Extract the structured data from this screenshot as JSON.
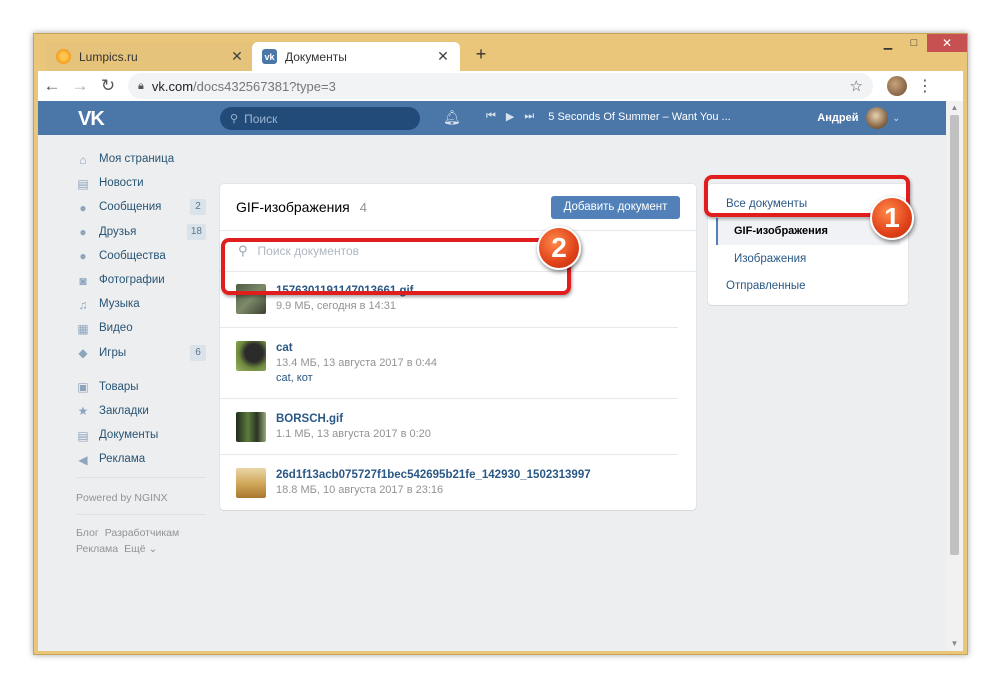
{
  "browser": {
    "tabs": [
      {
        "title": "Lumpics.ru",
        "active": false
      },
      {
        "title": "Документы",
        "active": true
      }
    ],
    "url_host": "vk.com",
    "url_path": "/docs432567381?type=3",
    "new_tab": "+",
    "close_glyph": "✕",
    "window_controls": {
      "minimize": "▁",
      "maximize": "□",
      "close": "✕"
    }
  },
  "vk_header": {
    "logo": "VK",
    "search_placeholder": "Поиск",
    "track": "5 Seconds Of Summer – Want You ...",
    "user_name": "Андрей"
  },
  "left_menu": {
    "items": [
      {
        "label": "Моя страница",
        "icon": "home-icon",
        "glyph": "⌂"
      },
      {
        "label": "Новости",
        "icon": "news-icon",
        "glyph": "▤"
      },
      {
        "label": "Сообщения",
        "icon": "messages-icon",
        "glyph": "●",
        "badge": "2"
      },
      {
        "label": "Друзья",
        "icon": "friends-icon",
        "glyph": "●",
        "badge": "18"
      },
      {
        "label": "Сообщества",
        "icon": "communities-icon",
        "glyph": "●"
      },
      {
        "label": "Фотографии",
        "icon": "camera-icon",
        "glyph": "◙"
      },
      {
        "label": "Музыка",
        "icon": "music-icon",
        "glyph": "♫"
      },
      {
        "label": "Видео",
        "icon": "video-icon",
        "glyph": "▦"
      },
      {
        "label": "Игры",
        "icon": "games-icon",
        "glyph": "◆",
        "badge": "6"
      }
    ],
    "items2": [
      {
        "label": "Товары",
        "icon": "market-icon",
        "glyph": "▣"
      },
      {
        "label": "Закладки",
        "icon": "bookmark-star-icon",
        "glyph": "★"
      },
      {
        "label": "Документы",
        "icon": "document-icon",
        "glyph": "▤"
      },
      {
        "label": "Реклама",
        "icon": "ads-icon",
        "glyph": "◀"
      }
    ],
    "powered": "Powered by NGINX",
    "footer": [
      "Блог",
      "Разработчикам",
      "Реклама",
      "Ещё ⌄"
    ]
  },
  "docs": {
    "title": "GIF-изображения",
    "count": "4",
    "add_button": "Добавить документ",
    "search_placeholder": "Поиск документов",
    "items": [
      {
        "name": "1576301191147013661.gif",
        "meta": "9.9 МБ, сегодня в 14:31",
        "tags": ""
      },
      {
        "name": "cat",
        "meta": "13.4 МБ, 13 августа 2017 в 0:44",
        "tags": "cat, кот"
      },
      {
        "name": "BORSCH.gif",
        "meta": "1.1 МБ, 13 августа 2017 в 0:20",
        "tags": ""
      },
      {
        "name": "26d1f13acb075727f1bec542695b21fe_142930_1502313997",
        "meta": "18.8 МБ, 10 августа 2017 в 23:16",
        "tags": ""
      }
    ]
  },
  "filters": {
    "items": [
      {
        "label": "Все документы"
      },
      {
        "label": "GIF-изображения",
        "selected": true
      },
      {
        "label": "Изображения"
      },
      {
        "label": "Отправленные"
      }
    ]
  },
  "callouts": [
    "1",
    "2"
  ],
  "colors": {
    "vk_blue": "#4a76a8",
    "accent_button": "#5181b8",
    "callout_red": "#e01e1e"
  }
}
